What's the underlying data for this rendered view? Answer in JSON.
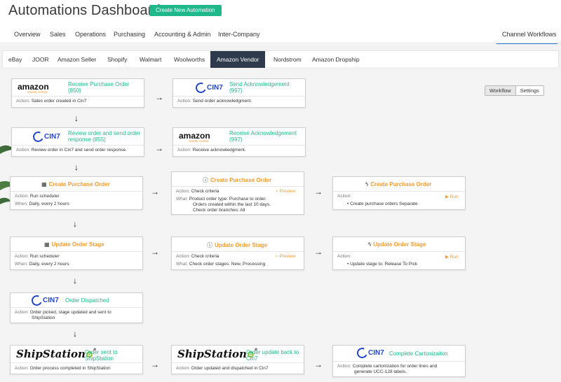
{
  "header": {
    "title": "Automations Dashboard",
    "create_label": "Create New Automation"
  },
  "top_nav": [
    "Overview",
    "Sales",
    "Operations",
    "Purchasing",
    "Accounting & Admin",
    "Inter-Company",
    "Channel Workflows"
  ],
  "sub_tabs": [
    "eBay",
    "JOOR",
    "Amazon Seller",
    "Shopify",
    "Walmart",
    "Woolworths",
    "Amazon Vendor",
    "Nordstrom",
    "Amazon Dropship"
  ],
  "toggle": {
    "workflow": "Workflow",
    "settings": "Settings"
  },
  "labels": {
    "action": "Action:",
    "when": "When:",
    "what": "What:",
    "preview": "Preview",
    "run": "Run"
  },
  "logos": {
    "amazon": "amazon",
    "amazon_sub": "vendor central",
    "cin7": "CIN7",
    "shipstation": "ShipStation"
  },
  "cards": {
    "c1": {
      "title": "Receive Purchase Order (850)",
      "action": "Sales order created in Cin7"
    },
    "c2": {
      "title": "Send Acknowledgement (997)",
      "action": "Send order acknowledgment."
    },
    "c3": {
      "title": "Review order and send order response (855)",
      "action": "Review order in Cin7 and send order response."
    },
    "c4": {
      "title": "Receive Acknowledgement (997)",
      "action": "Receive acknowledgment."
    },
    "c5": {
      "title": "Create Purchase Order",
      "action": "Run scheduler",
      "when": "Daily, every 2 hours"
    },
    "c6": {
      "title": "Create Purchase Order",
      "action": "Check criteria",
      "what": "Product order type: Purchase to order.",
      "what2": "Orders created within the last 10 days.",
      "what3": "Check order branches: All"
    },
    "c7": {
      "title": "Create Purchase Order",
      "bullet": "Create purchase orders Separate"
    },
    "c8": {
      "title": "Update Order Stage",
      "action": "Run scheduler",
      "when": "Daily, every 2 hours"
    },
    "c9": {
      "title": "Update Order Stage",
      "action": "Check criteria",
      "what": "Check order stages: New, Processing"
    },
    "c10": {
      "title": "Update Order Stage",
      "bullet": "Update stage to: Release To Pick"
    },
    "c11": {
      "title": "Order Dispatched",
      "action": "Order picked, stage updated and sent to",
      "action2": "ShipStation"
    },
    "c12": {
      "title": "Order sent to ShipStation",
      "action": "Order process completed in ShipStation"
    },
    "c13": {
      "title": "Order update back to Cin7",
      "action": "Order updated and dispatched in Cin7"
    },
    "c14": {
      "title": "Complete Cartonizaiton",
      "action": "Complete cartonization for order lines and",
      "action2": "generate UCC-128 labels."
    }
  },
  "colors": {
    "accent": "#1fb88b",
    "orange": "#f29b2e",
    "active_tab": "#2d3b4d",
    "cin7_blue": "#2245c7"
  }
}
